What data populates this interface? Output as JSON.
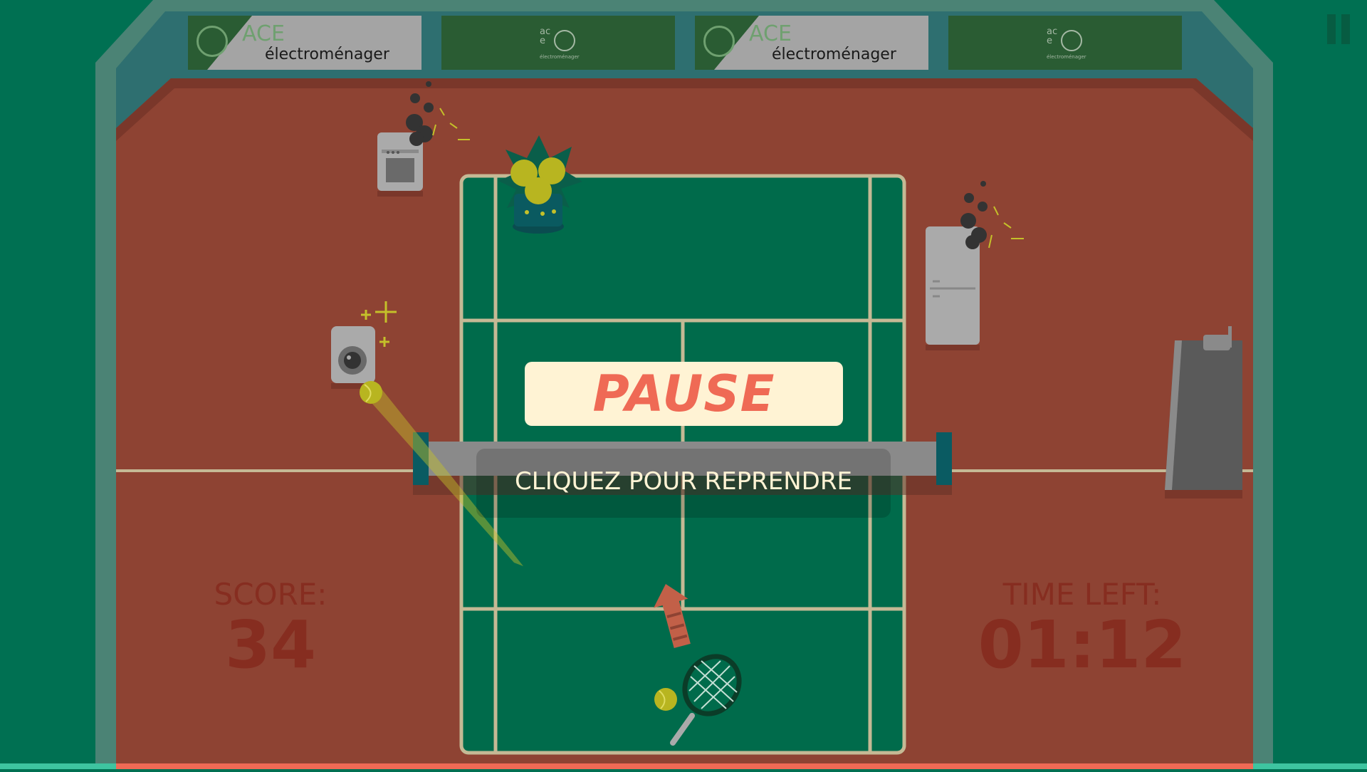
{
  "sponsors": [
    {
      "name": "ACE",
      "tagline": "électroménager",
      "style": "light"
    },
    {
      "name": "ace",
      "tagline": "électroménager",
      "style": "dark"
    },
    {
      "name": "ACE",
      "tagline": "électroménager",
      "style": "light"
    },
    {
      "name": "ace",
      "tagline": "électroménager",
      "style": "dark"
    }
  ],
  "pause": {
    "title": "PAUSE",
    "resume": "CLIQUEZ POUR REPRENDRE"
  },
  "hud": {
    "score_label": "SCORE:",
    "score_value": "34",
    "time_label": "TIME LEFT:",
    "time_value": "01:12"
  },
  "icons": {
    "pause": "pause-icon",
    "racket": "tennis-racket-icon",
    "ball": "tennis-ball-icon"
  },
  "colors": {
    "background": "#007052",
    "clay": "#8e4333",
    "court": "#006b4b",
    "lines": "#c5b995",
    "pause_bg": "#fff3d4",
    "pause_text": "#ef6a55",
    "hud_text": "#852a1d",
    "ball": "#c4c02a"
  }
}
